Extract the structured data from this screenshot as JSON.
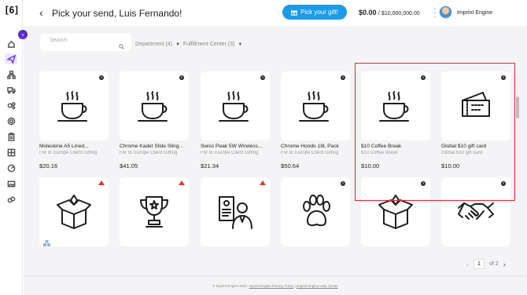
{
  "logo": "[6]",
  "header": {
    "title": "Pick your send, Luis Fernando!",
    "pick_button": "Pick your gift!",
    "budget_spent": "$0.00",
    "budget_separator": "/",
    "budget_total": "$10,000,000.00",
    "user_name": "Imprint Engine"
  },
  "search": {
    "placeholder": "Search"
  },
  "filters": {
    "department": "Department (4)",
    "fulfillment": "Fulfillment Center (3)"
  },
  "products": [
    {
      "name": "Moleskine A5 Lined...",
      "sub": "For IE Europe Client Gifting",
      "price": "$20.16",
      "icon": "coffee-cup-icon",
      "badge": "info"
    },
    {
      "name": "Chrome Kadet Slide Sling...",
      "sub": "For IE Europe Client Gifting",
      "price": "$41.05",
      "icon": "coffee-cup-icon",
      "badge": "info"
    },
    {
      "name": "Swiss Peak 5W Wireless...",
      "sub": "For IE Europe Client Gifting",
      "price": "$21.34",
      "icon": "coffee-cup-icon",
      "badge": "info"
    },
    {
      "name": "Chrome Hondo 18L Pack",
      "sub": "For IE Europe Client Gifting",
      "price": "$50.64",
      "icon": "coffee-cup-icon",
      "badge": "info"
    },
    {
      "name": "$10 Coffee Break",
      "sub": "$10 Coffee Break",
      "price": "$10.00",
      "icon": "coffee-cup-icon",
      "badge": "info"
    },
    {
      "name": "Global $10 gift card",
      "sub": "Global $10 gift card",
      "price": "$10.00",
      "icon": "gift-ticket-icon",
      "badge": "info"
    },
    {
      "icon": "gift-box-icon",
      "badge": "warning"
    },
    {
      "icon": "trophy-icon",
      "badge": "warning"
    },
    {
      "icon": "id-badge-person-icon",
      "badge": "warning"
    },
    {
      "icon": "paw-icon",
      "badge": "info"
    },
    {
      "icon": "gift-box-icon",
      "badge": "info"
    },
    {
      "icon": "handshake-icon",
      "badge": "info"
    }
  ],
  "pagination": {
    "current": "1",
    "of_label": "of 2"
  },
  "footer": {
    "copyright": "© Imprint Engine 2020.",
    "privacy": "Imprint Engine Privacy Policy",
    "separator": "|",
    "help": "Imprint Engine Help Center"
  },
  "colors": {
    "accent": "#1c9be8",
    "brand_purple": "#5b2bd6",
    "highlight": "#e8262d"
  }
}
